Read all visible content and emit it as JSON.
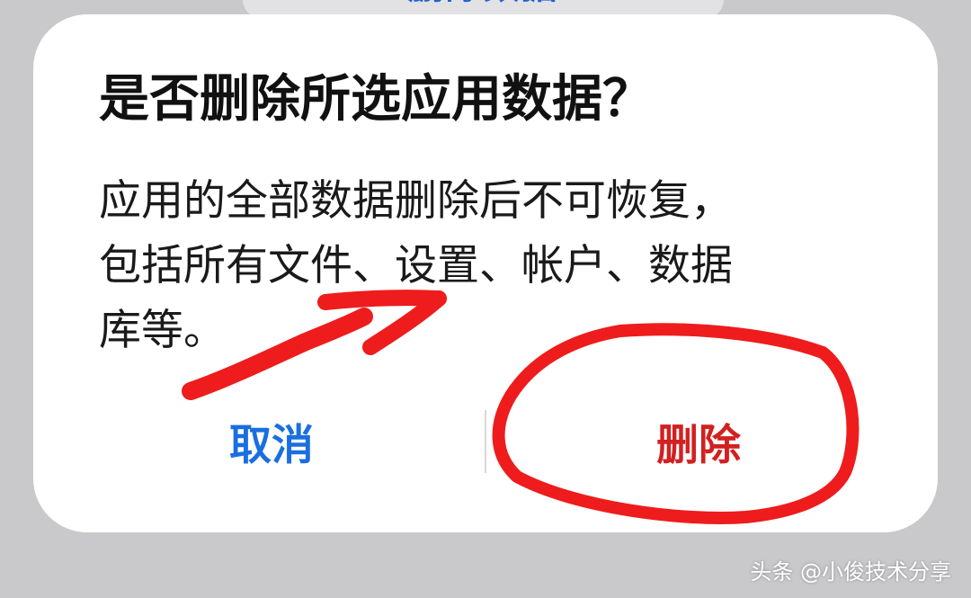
{
  "background_header": {
    "partial_text": "删除数据"
  },
  "dialog": {
    "title": "是否删除所选应用数据？",
    "message_lines": [
      "应用的全部数据删除后不可恢复，",
      "包括所有文件、设置、帐户、数据",
      "库等。"
    ],
    "cancel_label": "取消",
    "delete_label": "删除"
  },
  "colors": {
    "cancel": "#1a6fe0",
    "delete": "#d32020",
    "annotation": "#ee1c1c",
    "dialog_bg": "#ffffff",
    "page_bg": "#c9c9cb"
  },
  "annotations": {
    "arrow": "pointing-right-arrow",
    "circle": "circle-around-delete"
  },
  "watermark": "头条 @小俊技术分享"
}
